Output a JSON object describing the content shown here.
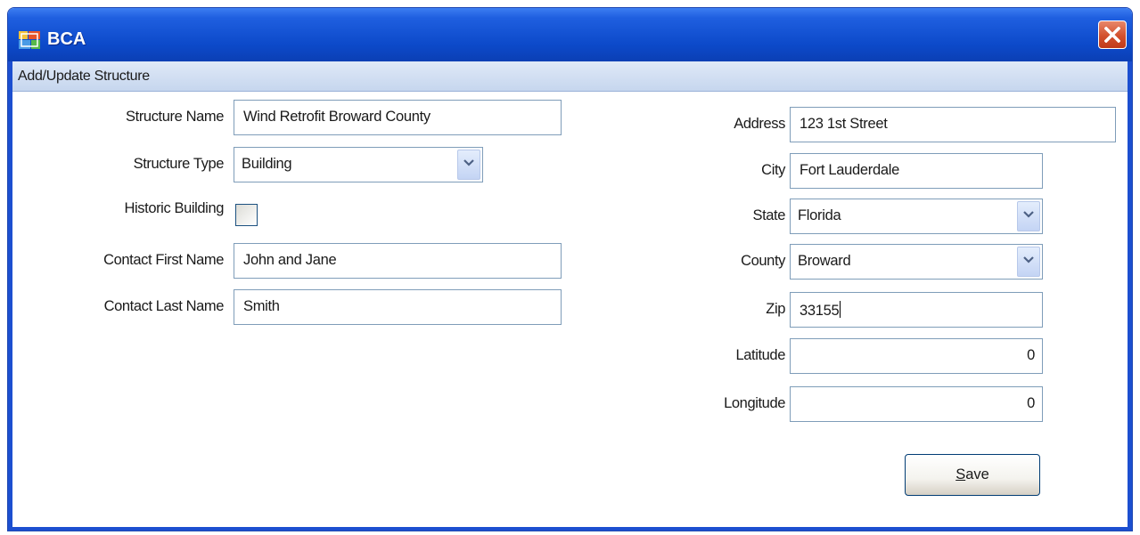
{
  "window": {
    "title": "BCA"
  },
  "section": {
    "title": "Add/Update Structure"
  },
  "form": {
    "structure_name": {
      "label": "Structure Name",
      "value": "Wind Retrofit Broward County"
    },
    "structure_type": {
      "label": "Structure Type",
      "value": "Building"
    },
    "historic_building": {
      "label": "Historic Building",
      "checked": false
    },
    "contact_first_name": {
      "label": "Contact First Name",
      "value": "John and Jane"
    },
    "contact_last_name": {
      "label": "Contact Last Name",
      "value": "Smith"
    },
    "address": {
      "label": "Address",
      "value": "123 1st Street"
    },
    "city": {
      "label": "City",
      "value": "Fort Lauderdale"
    },
    "state": {
      "label": "State",
      "value": "Florida"
    },
    "county": {
      "label": "County",
      "value": "Broward"
    },
    "zip": {
      "label": "Zip",
      "value": "33155"
    },
    "latitude": {
      "label": "Latitude",
      "value": "0"
    },
    "longitude": {
      "label": "Longitude",
      "value": "0"
    }
  },
  "buttons": {
    "save_accel": "S",
    "save_rest": "ave"
  },
  "icons": {
    "app": "app-icon",
    "close": "close-icon",
    "dropdown": "chevron-down-icon"
  },
  "colors": {
    "titlebar": "#0c49c9",
    "close": "#d2502d",
    "field_border": "#7f9db9"
  }
}
